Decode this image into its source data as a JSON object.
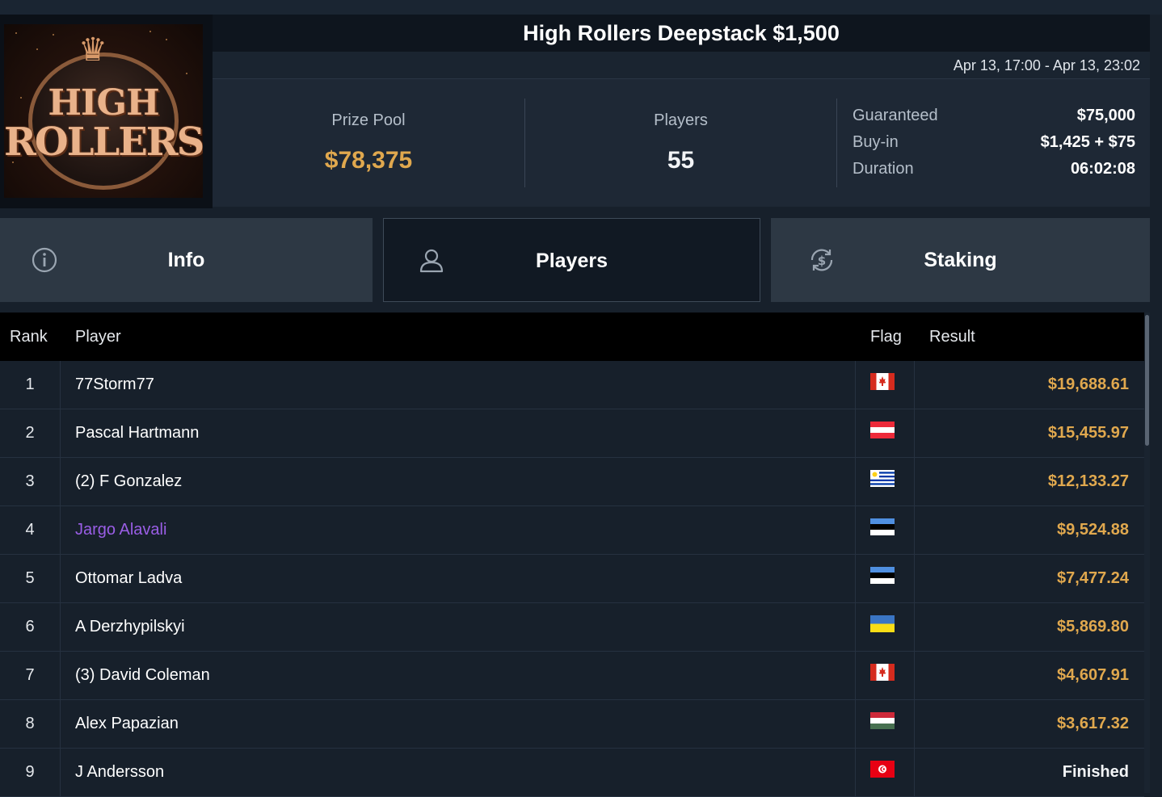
{
  "tournament": {
    "logo_text_line1": "HIGH",
    "logo_text_line2": "ROLLERS",
    "title": "High Rollers Deepstack $1,500",
    "date_range": "Apr 13, 17:00 - Apr 13, 23:02"
  },
  "stats": {
    "prize_pool_label": "Prize Pool",
    "prize_pool_value": "$78,375",
    "players_label": "Players",
    "players_value": "55",
    "details": [
      {
        "key": "Guaranteed",
        "value": "$75,000"
      },
      {
        "key": "Buy-in",
        "value": "$1,425 + $75"
      },
      {
        "key": "Duration",
        "value": "06:02:08"
      }
    ]
  },
  "tabs": [
    {
      "label": "Info",
      "icon": "info-icon",
      "active": false
    },
    {
      "label": "Players",
      "icon": "user-icon",
      "active": true
    },
    {
      "label": "Staking",
      "icon": "dollar-cycle-icon",
      "active": false
    }
  ],
  "table": {
    "headers": {
      "rank": "Rank",
      "player": "Player",
      "flag": "Flag",
      "result": "Result"
    },
    "rows": [
      {
        "rank": "1",
        "player": "77Storm77",
        "flag": "canada",
        "result": "$19,688.61"
      },
      {
        "rank": "2",
        "player": "Pascal Hartmann",
        "flag": "austria",
        "result": "$15,455.97"
      },
      {
        "rank": "3",
        "player": "(2) F Gonzalez",
        "flag": "uruguay",
        "result": "$12,133.27"
      },
      {
        "rank": "4",
        "player": "Jargo Alavali",
        "flag": "estonia",
        "result": "$9,524.88",
        "highlight": true
      },
      {
        "rank": "5",
        "player": "Ottomar Ladva",
        "flag": "estonia",
        "result": "$7,477.24"
      },
      {
        "rank": "6",
        "player": "A Derzhypilskyi",
        "flag": "ukraine",
        "result": "$5,869.80"
      },
      {
        "rank": "7",
        "player": "(3) David Coleman",
        "flag": "canada",
        "result": "$4,607.91"
      },
      {
        "rank": "8",
        "player": "Alex Papazian",
        "flag": "hungary",
        "result": "$3,617.32"
      },
      {
        "rank": "9",
        "player": "J Andersson",
        "flag": "tunisia",
        "result": "Finished"
      }
    ]
  },
  "colors": {
    "accent_gold": "#e0a84e",
    "highlight_purple": "#9a5ee6",
    "background": "#17202b"
  }
}
